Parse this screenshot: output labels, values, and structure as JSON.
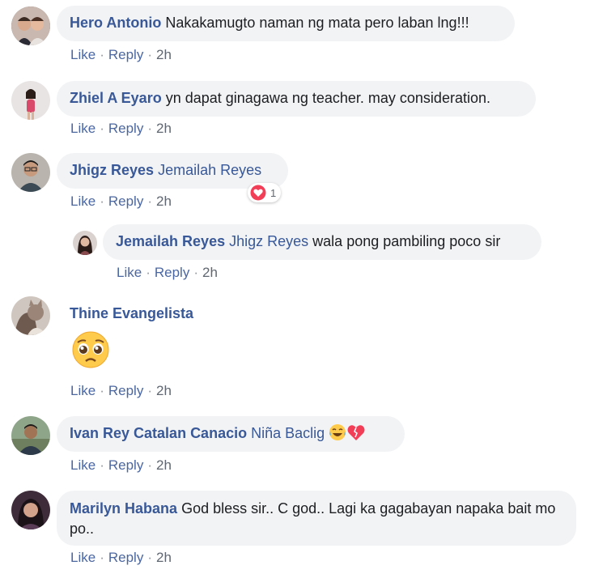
{
  "comments": [
    {
      "author": "Hero Antonio",
      "mention": "",
      "text": "Nakakamugto naman ng mata pero laban lng!!!",
      "like": "Like",
      "reply": "Reply",
      "time": "2h"
    },
    {
      "author": "Zhiel A Eyaro",
      "mention": "",
      "text": "yn dapat ginagawa ng teacher. may consideration.",
      "like": "Like",
      "reply": "Reply",
      "time": "2h"
    },
    {
      "author": "Jhigz Reyes",
      "mention": "Jemailah Reyes",
      "text": "",
      "like": "Like",
      "reply": "Reply",
      "time": "2h",
      "reaction_count": "1"
    },
    {
      "author": "Jemailah Reyes",
      "mention": "Jhigz Reyes",
      "text": "wala pong pambiling poco sir",
      "like": "Like",
      "reply": "Reply",
      "time": "2h"
    },
    {
      "author": "Thine Evangelista",
      "mention": "",
      "text": "",
      "like": "Like",
      "reply": "Reply",
      "time": "2h",
      "emoji": "pleading-face-icon"
    },
    {
      "author": "Ivan Rey Catalan Canacio",
      "mention": "Niña Baclig",
      "text": "",
      "like": "Like",
      "reply": "Reply",
      "time": "2h",
      "emojis": [
        "crying-laughing-face-icon",
        "broken-heart-icon"
      ]
    },
    {
      "author": "Marilyn Habana",
      "mention": "",
      "text": "God bless sir.. C god.. Lagi ka gagabayan napaka bait mo po..",
      "like": "Like",
      "reply": "Reply",
      "time": "2h"
    }
  ],
  "colors": {
    "author": "#385898",
    "bubble": "#f2f3f5",
    "action": "#4b67a1",
    "heart": "#f33e58"
  }
}
